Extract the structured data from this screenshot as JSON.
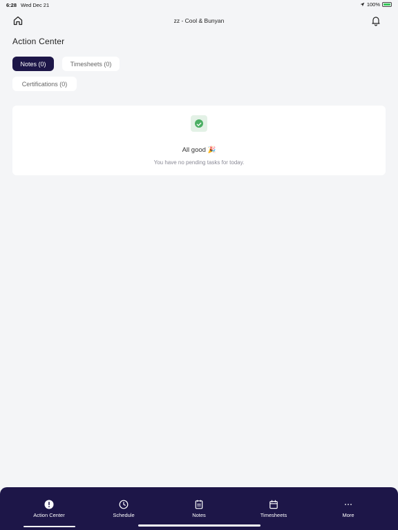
{
  "status_bar": {
    "time": "6:28",
    "date": "Wed Dec 21",
    "battery": "100%"
  },
  "header": {
    "title": "zz - Cool & Bunyan"
  },
  "page": {
    "title": "Action Center"
  },
  "tabs": [
    {
      "label": "Notes (0)",
      "active": true
    },
    {
      "label": "Timesheets (0)",
      "active": false
    },
    {
      "label": "Certifications (0)",
      "active": false
    }
  ],
  "empty_state": {
    "title": "All good 🎉",
    "subtitle": "You have no pending tasks for today."
  },
  "bottom_nav": [
    {
      "label": "Action Center",
      "icon": "alert-icon",
      "active": true
    },
    {
      "label": "Schedule",
      "icon": "clock-icon",
      "active": false
    },
    {
      "label": "Notes",
      "icon": "notepad-icon",
      "active": false
    },
    {
      "label": "Timesheets",
      "icon": "calendar-icon",
      "active": false
    },
    {
      "label": "More",
      "icon": "more-icon",
      "active": false
    }
  ],
  "colors": {
    "primary": "#1d1648",
    "background": "#f4f5f7",
    "success": "#4caf64"
  }
}
